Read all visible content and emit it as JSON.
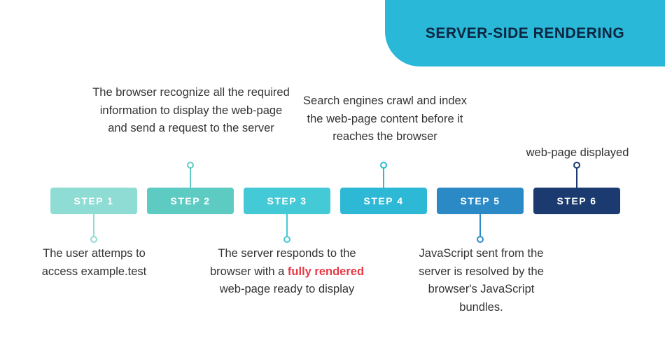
{
  "banner": {
    "title": "SERVER-SIDE RENDERING"
  },
  "steps": [
    {
      "label": "STEP 1",
      "color": "#8edcd3"
    },
    {
      "label": "STEP 2",
      "color": "#5ecbc3"
    },
    {
      "label": "STEP 3",
      "color": "#44c9d6"
    },
    {
      "label": "STEP 4",
      "color": "#2db9d6"
    },
    {
      "label": "STEP 5",
      "color": "#2b89c6"
    },
    {
      "label": "STEP 6",
      "color": "#1b3a70"
    }
  ],
  "descriptions": {
    "d1": "The user attemps to access example.test",
    "d2": "The browser recognize all the required information to display the web-page and send a request to the server",
    "d3_pre": "The server responds to the browser with a ",
    "d3_hl": "fully rendered",
    "d3_post": " web-page ready to display",
    "d4": "Search engines crawl and index the web-page content before it reaches the browser",
    "d5": "JavaScript sent from the server is resolved by the browser's JavaScript bundles.",
    "d6": "web-page displayed"
  }
}
